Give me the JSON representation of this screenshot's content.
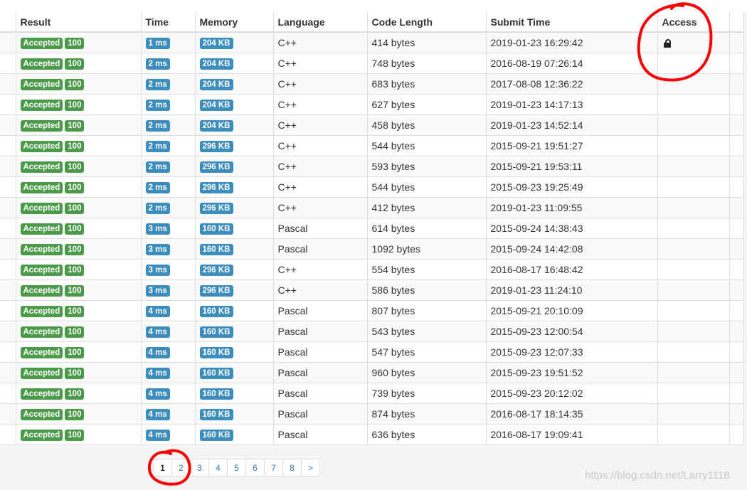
{
  "table": {
    "headers": [
      "Result",
      "Time",
      "Memory",
      "Language",
      "Code Length",
      "Submit Time",
      "Access"
    ],
    "rows": [
      {
        "result": "Accepted",
        "score": "100",
        "time": "1 ms",
        "memory": "204 KB",
        "language": "C++",
        "length": "414 bytes",
        "submit": "2019-01-23 16:29:42",
        "locked": true
      },
      {
        "result": "Accepted",
        "score": "100",
        "time": "2 ms",
        "memory": "204 KB",
        "language": "C++",
        "length": "748 bytes",
        "submit": "2016-08-19 07:26:14",
        "locked": false
      },
      {
        "result": "Accepted",
        "score": "100",
        "time": "2 ms",
        "memory": "204 KB",
        "language": "C++",
        "length": "683 bytes",
        "submit": "2017-08-08 12:36:22",
        "locked": false
      },
      {
        "result": "Accepted",
        "score": "100",
        "time": "2 ms",
        "memory": "204 KB",
        "language": "C++",
        "length": "627 bytes",
        "submit": "2019-01-23 14:17:13",
        "locked": false
      },
      {
        "result": "Accepted",
        "score": "100",
        "time": "2 ms",
        "memory": "204 KB",
        "language": "C++",
        "length": "458 bytes",
        "submit": "2019-01-23 14:52:14",
        "locked": false
      },
      {
        "result": "Accepted",
        "score": "100",
        "time": "2 ms",
        "memory": "296 KB",
        "language": "C++",
        "length": "544 bytes",
        "submit": "2015-09-21 19:51:27",
        "locked": false
      },
      {
        "result": "Accepted",
        "score": "100",
        "time": "2 ms",
        "memory": "296 KB",
        "language": "C++",
        "length": "593 bytes",
        "submit": "2015-09-21 19:53:11",
        "locked": false
      },
      {
        "result": "Accepted",
        "score": "100",
        "time": "2 ms",
        "memory": "296 KB",
        "language": "C++",
        "length": "544 bytes",
        "submit": "2015-09-23 19:25:49",
        "locked": false
      },
      {
        "result": "Accepted",
        "score": "100",
        "time": "2 ms",
        "memory": "296 KB",
        "language": "C++",
        "length": "412 bytes",
        "submit": "2019-01-23 11:09:55",
        "locked": false
      },
      {
        "result": "Accepted",
        "score": "100",
        "time": "3 ms",
        "memory": "160 KB",
        "language": "Pascal",
        "length": "614 bytes",
        "submit": "2015-09-24 14:38:43",
        "locked": false
      },
      {
        "result": "Accepted",
        "score": "100",
        "time": "3 ms",
        "memory": "160 KB",
        "language": "Pascal",
        "length": "1092 bytes",
        "submit": "2015-09-24 14:42:08",
        "locked": false
      },
      {
        "result": "Accepted",
        "score": "100",
        "time": "3 ms",
        "memory": "296 KB",
        "language": "C++",
        "length": "554 bytes",
        "submit": "2016-08-17 16:48:42",
        "locked": false
      },
      {
        "result": "Accepted",
        "score": "100",
        "time": "3 ms",
        "memory": "296 KB",
        "language": "C++",
        "length": "586 bytes",
        "submit": "2019-01-23 11:24:10",
        "locked": false
      },
      {
        "result": "Accepted",
        "score": "100",
        "time": "4 ms",
        "memory": "160 KB",
        "language": "Pascal",
        "length": "807 bytes",
        "submit": "2015-09-21 20:10:09",
        "locked": false
      },
      {
        "result": "Accepted",
        "score": "100",
        "time": "4 ms",
        "memory": "160 KB",
        "language": "Pascal",
        "length": "543 bytes",
        "submit": "2015-09-23 12:00:54",
        "locked": false
      },
      {
        "result": "Accepted",
        "score": "100",
        "time": "4 ms",
        "memory": "160 KB",
        "language": "Pascal",
        "length": "547 bytes",
        "submit": "2015-09-23 12:07:33",
        "locked": false
      },
      {
        "result": "Accepted",
        "score": "100",
        "time": "4 ms",
        "memory": "160 KB",
        "language": "Pascal",
        "length": "960 bytes",
        "submit": "2015-09-23 19:51:52",
        "locked": false
      },
      {
        "result": "Accepted",
        "score": "100",
        "time": "4 ms",
        "memory": "160 KB",
        "language": "Pascal",
        "length": "739 bytes",
        "submit": "2015-09-23 20:12:02",
        "locked": false
      },
      {
        "result": "Accepted",
        "score": "100",
        "time": "4 ms",
        "memory": "160 KB",
        "language": "Pascal",
        "length": "874 bytes",
        "submit": "2016-08-17 18:14:35",
        "locked": false
      },
      {
        "result": "Accepted",
        "score": "100",
        "time": "4 ms",
        "memory": "160 KB",
        "language": "Pascal",
        "length": "636 bytes",
        "submit": "2016-08-17 19:09:41",
        "locked": false
      }
    ]
  },
  "pagination": {
    "pages": [
      "1",
      "2",
      "3",
      "4",
      "5",
      "6",
      "7",
      "8"
    ],
    "active": "1",
    "next_label": ">"
  },
  "colors": {
    "result_label": "#4a9a4a",
    "time_label": "#3b8dbd",
    "annotation": "#ff0000"
  },
  "icons": {
    "access": "lock-icon"
  },
  "watermark": "https://blog.csdn.net/Larry1118"
}
